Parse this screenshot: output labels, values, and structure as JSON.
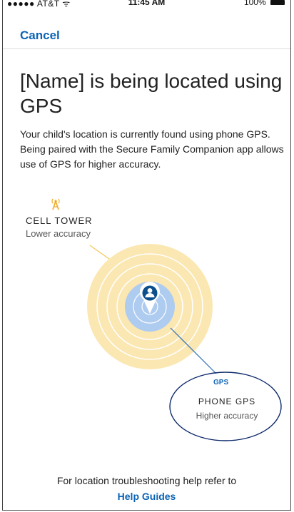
{
  "status_bar": {
    "carrier": "●●●●● AT&T ᯤ",
    "time": "11:45 AM",
    "battery": "100%"
  },
  "nav": {
    "cancel_label": "Cancel"
  },
  "title": "[Name] is being located using GPS",
  "description": "Your child's location is currently found using phone GPS. Being paired with the Secure Family Companion app allows use of GPS for higher accuracy.",
  "cell_tower": {
    "title": "CELL TOWER",
    "subtitle": "Lower accuracy",
    "icon": "cell-tower-icon"
  },
  "phone_gps": {
    "badge": "GPS",
    "title": "PHONE GPS",
    "subtitle": "Higher accuracy"
  },
  "footer": {
    "text": "For location troubleshooting help refer to",
    "link_label": "Help Guides"
  },
  "colors": {
    "accent": "#0b63b5",
    "tower_circle": "#fbe7b2",
    "gps_circle": "#aecbf0",
    "pin": "#0b63b5"
  }
}
